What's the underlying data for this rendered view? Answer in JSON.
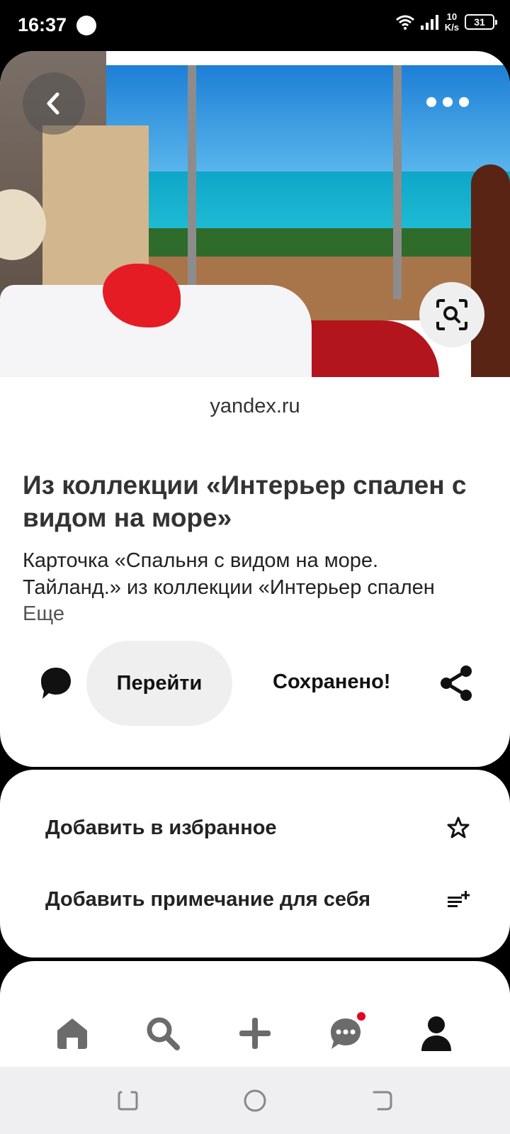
{
  "status_bar": {
    "time": "16:37",
    "net_speed_value": "10",
    "net_speed_unit": "K/s",
    "battery": "31"
  },
  "pin": {
    "source": "yandex.ru",
    "title": "Из коллекции «Интерьер спален с видом на море»",
    "description_line1": "Карточка «Спальня с видом на море.",
    "description_line2": "Тайланд.» из коллекции «Интерьер спален",
    "more_link": "Еще"
  },
  "actions": {
    "go_label": "Перейти",
    "saved_label": "Сохранено!"
  },
  "options": {
    "add_favorite": "Добавить в избранное",
    "add_note": "Добавить примечание для себя"
  },
  "icons": {
    "back": "chevron-left-icon",
    "more": "more-horizontal-icon",
    "visual_search": "lens-search-icon",
    "comment": "comment-icon",
    "share": "share-icon",
    "favorite": "star-icon",
    "note": "note-add-icon",
    "nav": [
      "home-icon",
      "search-icon",
      "plus-icon",
      "messages-icon",
      "profile-icon"
    ]
  },
  "colors": {
    "accent_dot": "#e60023",
    "button_bg": "#efefef"
  }
}
